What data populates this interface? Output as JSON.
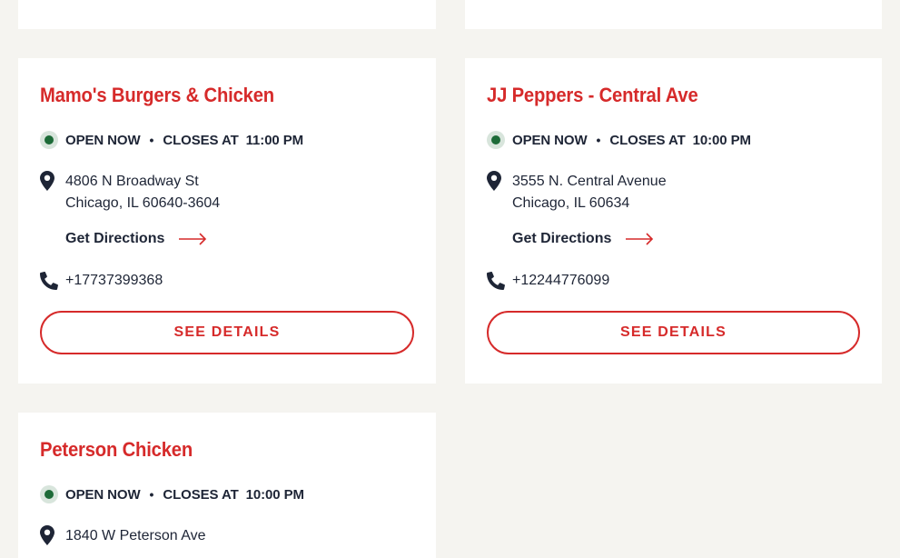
{
  "colors": {
    "accent": "#d62a2a",
    "text": "#1e2536",
    "open_dot": "#1d6b38",
    "background": "#f5f4f0"
  },
  "locations": [
    {
      "name": "Mamo's Burgers & Chicken",
      "status": "OPEN NOW",
      "closes_label": "CLOSES AT",
      "closes_time": "11:00 PM",
      "address_line1": "4806 N Broadway St",
      "address_line2": "Chicago, IL 60640-3604",
      "directions_label": "Get Directions",
      "phone": "+17737399368",
      "details_label": "SEE DETAILS"
    },
    {
      "name": "JJ Peppers - Central Ave",
      "status": "OPEN NOW",
      "closes_label": "CLOSES AT",
      "closes_time": "10:00 PM",
      "address_line1": "3555 N. Central Avenue",
      "address_line2": "Chicago, IL 60634",
      "directions_label": "Get Directions",
      "phone": "+12244776099",
      "details_label": "SEE DETAILS"
    },
    {
      "name": "Peterson Chicken",
      "status": "OPEN NOW",
      "closes_label": "CLOSES AT",
      "closes_time": "10:00 PM",
      "address_line1": "1840 W Peterson Ave"
    }
  ],
  "icons": {
    "status": "open-status-icon",
    "address": "map-pin-icon",
    "directions": "arrow-right-icon",
    "phone": "phone-icon"
  }
}
